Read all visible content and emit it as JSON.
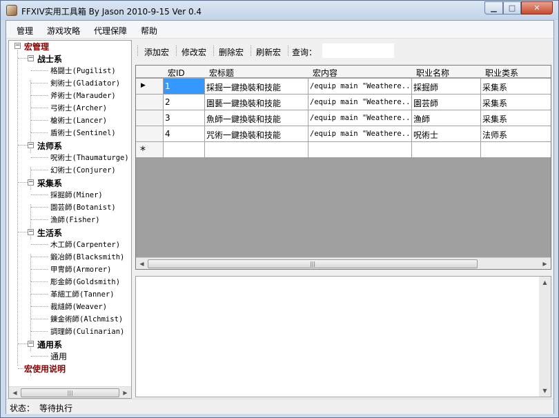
{
  "window": {
    "title": "FFXIV实用工具箱 By Jason 2010-9-15 Ver 0.4",
    "min_glyph": "▁",
    "max_glyph": "□",
    "close_glyph": "✕"
  },
  "menu": [
    "管理",
    "游戏攻略",
    "代理保障",
    "帮助"
  ],
  "tree": {
    "root": "宏管理",
    "categories": [
      {
        "label": "战士系",
        "items": [
          "格闘士(Pugilist)",
          "剣術士(Gladiator)",
          "斧術士(Marauder)",
          "弓術士(Archer)",
          "槍術士(Lancer)",
          "盾術士(Sentinel)"
        ]
      },
      {
        "label": "法师系",
        "items": [
          "呪術士(Thaumaturge)",
          "幻術士(Conjurer)"
        ]
      },
      {
        "label": "采集系",
        "items": [
          "採掘師(Miner)",
          "園芸師(Botanist)",
          "漁師(Fisher)"
        ]
      },
      {
        "label": "生活系",
        "items": [
          "木工師(Carpenter)",
          "鍛冶師(Blacksmith)",
          "甲冑師(Armorer)",
          "彫金師(Goldsmith)",
          "革細工師(Tanner)",
          "裁縫師(Weaver)",
          "錬金術師(Alchmist)",
          "調理師(Culinarian)"
        ]
      },
      {
        "label": "通用系",
        "items": [
          "通用"
        ]
      }
    ],
    "root2": "宏使用说明",
    "toggle_minus": "−"
  },
  "toolbar": {
    "add": "添加宏",
    "edit": "修改宏",
    "delete": "删除宏",
    "refresh": "刷新宏",
    "search_label": "查询：",
    "search_value": ""
  },
  "grid": {
    "columns": [
      "宏ID",
      "宏标题",
      "宏内容",
      "职业名称",
      "职业类系"
    ],
    "rows": [
      [
        "1",
        "採掘一鍵換裝和技能",
        "/equip main \"Weathere...",
        "採掘師",
        "采集系"
      ],
      [
        "2",
        "園藝一鍵換裝和技能",
        "/equip main \"Weathere...",
        "園芸師",
        "采集系"
      ],
      [
        "3",
        "魚師一鍵換裝和技能",
        "/equip main \"Weathere...",
        "漁師",
        "采集系"
      ],
      [
        "4",
        "咒術一鍵換裝和技能",
        "/equip main \"Weathere...",
        "呪術士",
        "法师系"
      ]
    ],
    "current_row_marker": "▶",
    "new_row_marker": "*"
  },
  "status": {
    "label": "状态：",
    "value": "等待执行"
  },
  "scroll_glyphs": {
    "left": "◀",
    "right": "▶",
    "up": "▲",
    "down": "▼",
    "grip": "|||"
  }
}
